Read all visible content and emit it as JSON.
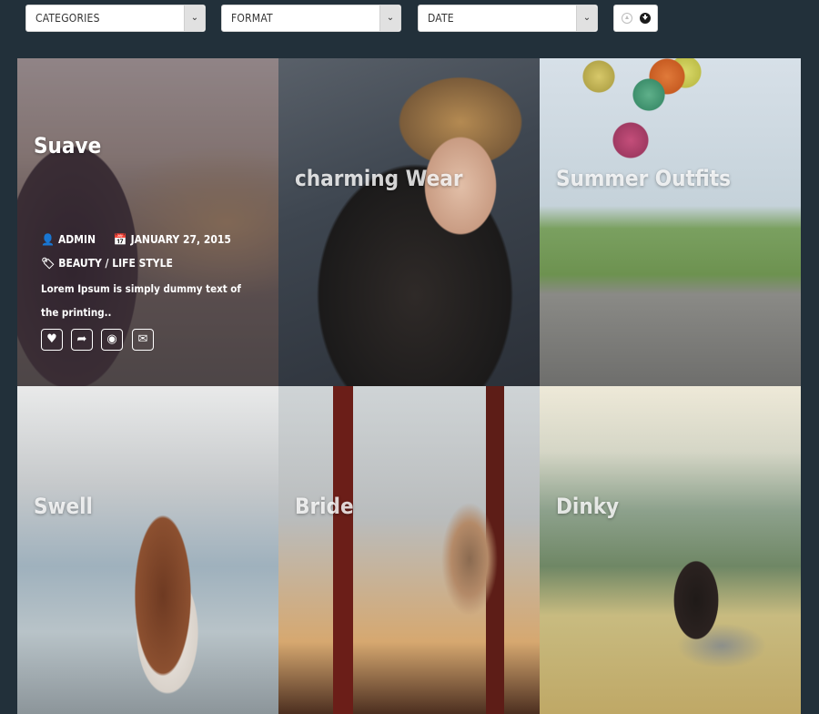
{
  "filters": {
    "categories": {
      "label": "CATEGORIES",
      "arrow": "⌄"
    },
    "format": {
      "label": "FORMAT",
      "arrow": "⌄"
    },
    "date": {
      "label": "DATE",
      "arrow": "⌄"
    }
  },
  "order_toggle": {
    "icons": [
      "sort-ascending-icon",
      "sort-descending-icon"
    ],
    "active": "descending"
  },
  "tiles": [
    {
      "title": "Suave",
      "author": "ADMIN",
      "date": "JANUARY 27, 2015",
      "categories": "BEAUTY / LIFE STYLE",
      "excerpt": "Lorem Ipsum is simply dummy text of the printing..",
      "actions": [
        "heart-icon",
        "share-icon",
        "eye-icon",
        "envelope-icon"
      ]
    },
    {
      "title": "charming Wear"
    },
    {
      "title": "Summer Outfits"
    },
    {
      "title": "Swell"
    },
    {
      "title": "Bride"
    },
    {
      "title": "Dinky"
    }
  ]
}
